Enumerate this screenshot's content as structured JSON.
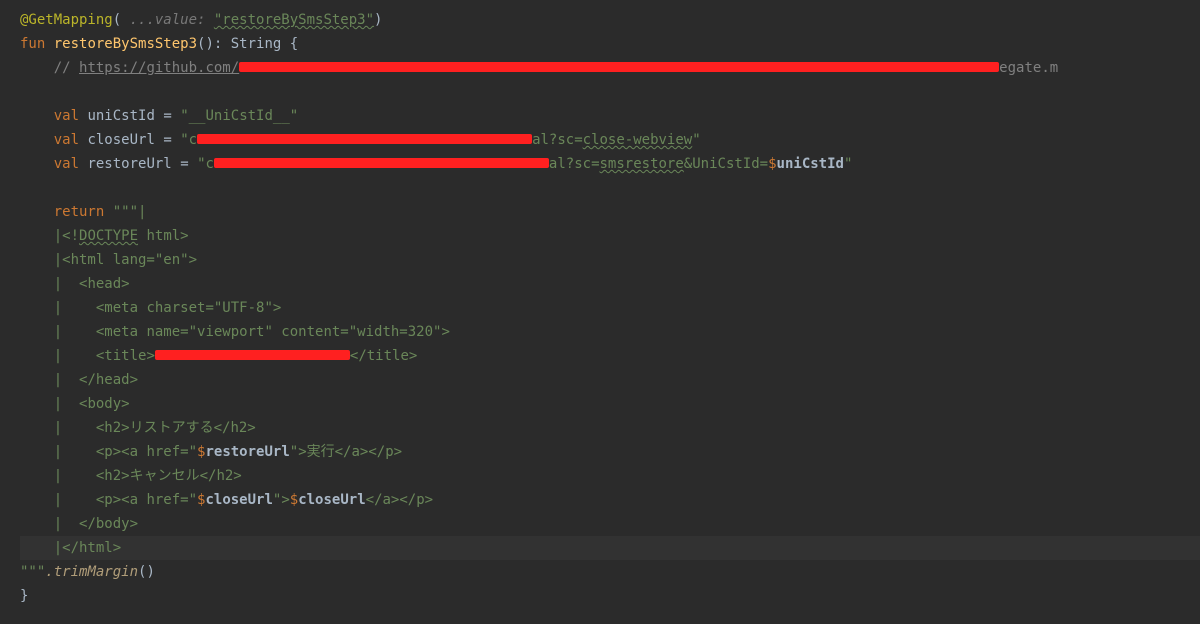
{
  "code": {
    "annotation": "@GetMapping",
    "annotation_hint": " ...value: ",
    "mapping_value": "\"restoreBySmsStep3\"",
    "fun_keyword": "fun",
    "func_name": "restoreBySmsStep3",
    "return_type": ": String {",
    "comment_prefix": "// ",
    "comment_url": "https://github.com/",
    "comment_suffix": "egate.m",
    "val_keyword": "val",
    "var_uniCstId": "uniCstId",
    "uniCstId_value": "\"__UniCstId__\"",
    "var_closeUrl": "closeUrl",
    "closeUrl_prefix": "\"c",
    "closeUrl_mid": "al?sc=",
    "closeUrl_suffix": "close-webview",
    "var_restoreUrl": "restoreUrl",
    "restoreUrl_prefix": "\"c",
    "restoreUrl_mid": "al?sc=",
    "restoreUrl_suffix1": "smsrestore",
    "restoreUrl_suffix2": "&UniCstId=",
    "restoreUrl_template": "$uniCstId",
    "return_keyword": "return",
    "triple_quote_open": "\"\"\"|",
    "html_doctype": "|<!DOCTYPE html>",
    "html_open": "|<html lang=\"en\">",
    "pipe": "|",
    "head_open": "<head>",
    "meta_charset": "<meta charset=\"UTF-8\">",
    "meta_viewport": "<meta name=\"viewport\" content=\"width=320\">",
    "title_open": "<title>",
    "title_close": "</title>",
    "head_close": "</head>",
    "body_open": "<body>",
    "h2_restore": "<h2>リストアする</h2>",
    "p_open": "<p><a href=\"",
    "restore_tpl": "$restoreUrl",
    "a_mid": "\">",
    "restore_text": "実行",
    "a_close": "</a></p>",
    "h2_cancel": "<h2>キャンセル</h2>",
    "close_tpl": "$closeUrl",
    "close_tpl2": "$closeUrl",
    "body_close": "</body>",
    "html_close": "|</html>",
    "triple_quote_close": "\"\"\"",
    "trim_method": ".trimMargin",
    "close_brace": "}"
  }
}
